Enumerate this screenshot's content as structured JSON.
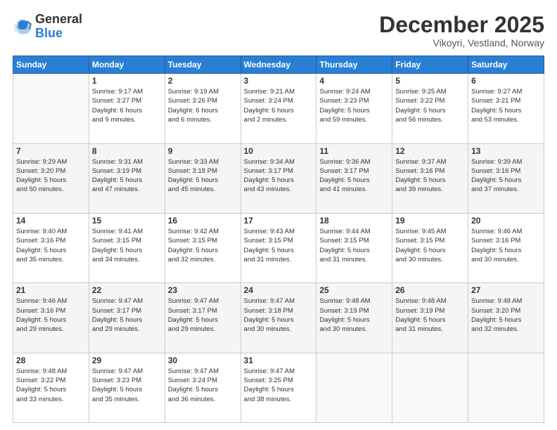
{
  "logo": {
    "general": "General",
    "blue": "Blue"
  },
  "header": {
    "month": "December 2025",
    "location": "Vikoyri, Vestland, Norway"
  },
  "weekdays": [
    "Sunday",
    "Monday",
    "Tuesday",
    "Wednesday",
    "Thursday",
    "Friday",
    "Saturday"
  ],
  "weeks": [
    [
      {
        "day": "",
        "info": ""
      },
      {
        "day": "1",
        "info": "Sunrise: 9:17 AM\nSunset: 3:27 PM\nDaylight: 6 hours\nand 9 minutes."
      },
      {
        "day": "2",
        "info": "Sunrise: 9:19 AM\nSunset: 3:26 PM\nDaylight: 6 hours\nand 6 minutes."
      },
      {
        "day": "3",
        "info": "Sunrise: 9:21 AM\nSunset: 3:24 PM\nDaylight: 6 hours\nand 2 minutes."
      },
      {
        "day": "4",
        "info": "Sunrise: 9:24 AM\nSunset: 3:23 PM\nDaylight: 5 hours\nand 59 minutes."
      },
      {
        "day": "5",
        "info": "Sunrise: 9:25 AM\nSunset: 3:22 PM\nDaylight: 5 hours\nand 56 minutes."
      },
      {
        "day": "6",
        "info": "Sunrise: 9:27 AM\nSunset: 3:21 PM\nDaylight: 5 hours\nand 53 minutes."
      }
    ],
    [
      {
        "day": "7",
        "info": "Sunrise: 9:29 AM\nSunset: 3:20 PM\nDaylight: 5 hours\nand 50 minutes."
      },
      {
        "day": "8",
        "info": "Sunrise: 9:31 AM\nSunset: 3:19 PM\nDaylight: 5 hours\nand 47 minutes."
      },
      {
        "day": "9",
        "info": "Sunrise: 9:33 AM\nSunset: 3:18 PM\nDaylight: 5 hours\nand 45 minutes."
      },
      {
        "day": "10",
        "info": "Sunrise: 9:34 AM\nSunset: 3:17 PM\nDaylight: 5 hours\nand 43 minutes."
      },
      {
        "day": "11",
        "info": "Sunrise: 9:36 AM\nSunset: 3:17 PM\nDaylight: 5 hours\nand 41 minutes."
      },
      {
        "day": "12",
        "info": "Sunrise: 9:37 AM\nSunset: 3:16 PM\nDaylight: 5 hours\nand 39 minutes."
      },
      {
        "day": "13",
        "info": "Sunrise: 9:39 AM\nSunset: 3:16 PM\nDaylight: 5 hours\nand 37 minutes."
      }
    ],
    [
      {
        "day": "14",
        "info": "Sunrise: 9:40 AM\nSunset: 3:16 PM\nDaylight: 5 hours\nand 35 minutes."
      },
      {
        "day": "15",
        "info": "Sunrise: 9:41 AM\nSunset: 3:15 PM\nDaylight: 5 hours\nand 34 minutes."
      },
      {
        "day": "16",
        "info": "Sunrise: 9:42 AM\nSunset: 3:15 PM\nDaylight: 5 hours\nand 32 minutes."
      },
      {
        "day": "17",
        "info": "Sunrise: 9:43 AM\nSunset: 3:15 PM\nDaylight: 5 hours\nand 31 minutes."
      },
      {
        "day": "18",
        "info": "Sunrise: 9:44 AM\nSunset: 3:15 PM\nDaylight: 5 hours\nand 31 minutes."
      },
      {
        "day": "19",
        "info": "Sunrise: 9:45 AM\nSunset: 3:15 PM\nDaylight: 5 hours\nand 30 minutes."
      },
      {
        "day": "20",
        "info": "Sunrise: 9:46 AM\nSunset: 3:16 PM\nDaylight: 5 hours\nand 30 minutes."
      }
    ],
    [
      {
        "day": "21",
        "info": "Sunrise: 9:46 AM\nSunset: 3:16 PM\nDaylight: 5 hours\nand 29 minutes."
      },
      {
        "day": "22",
        "info": "Sunrise: 9:47 AM\nSunset: 3:17 PM\nDaylight: 5 hours\nand 29 minutes."
      },
      {
        "day": "23",
        "info": "Sunrise: 9:47 AM\nSunset: 3:17 PM\nDaylight: 5 hours\nand 29 minutes."
      },
      {
        "day": "24",
        "info": "Sunrise: 9:47 AM\nSunset: 3:18 PM\nDaylight: 5 hours\nand 30 minutes."
      },
      {
        "day": "25",
        "info": "Sunrise: 9:48 AM\nSunset: 3:19 PM\nDaylight: 5 hours\nand 30 minutes."
      },
      {
        "day": "26",
        "info": "Sunrise: 9:48 AM\nSunset: 3:19 PM\nDaylight: 5 hours\nand 31 minutes."
      },
      {
        "day": "27",
        "info": "Sunrise: 9:48 AM\nSunset: 3:20 PM\nDaylight: 5 hours\nand 32 minutes."
      }
    ],
    [
      {
        "day": "28",
        "info": "Sunrise: 9:48 AM\nSunset: 3:22 PM\nDaylight: 5 hours\nand 33 minutes."
      },
      {
        "day": "29",
        "info": "Sunrise: 9:47 AM\nSunset: 3:23 PM\nDaylight: 5 hours\nand 35 minutes."
      },
      {
        "day": "30",
        "info": "Sunrise: 9:47 AM\nSunset: 3:24 PM\nDaylight: 5 hours\nand 36 minutes."
      },
      {
        "day": "31",
        "info": "Sunrise: 9:47 AM\nSunset: 3:25 PM\nDaylight: 5 hours\nand 38 minutes."
      },
      {
        "day": "",
        "info": ""
      },
      {
        "day": "",
        "info": ""
      },
      {
        "day": "",
        "info": ""
      }
    ]
  ]
}
